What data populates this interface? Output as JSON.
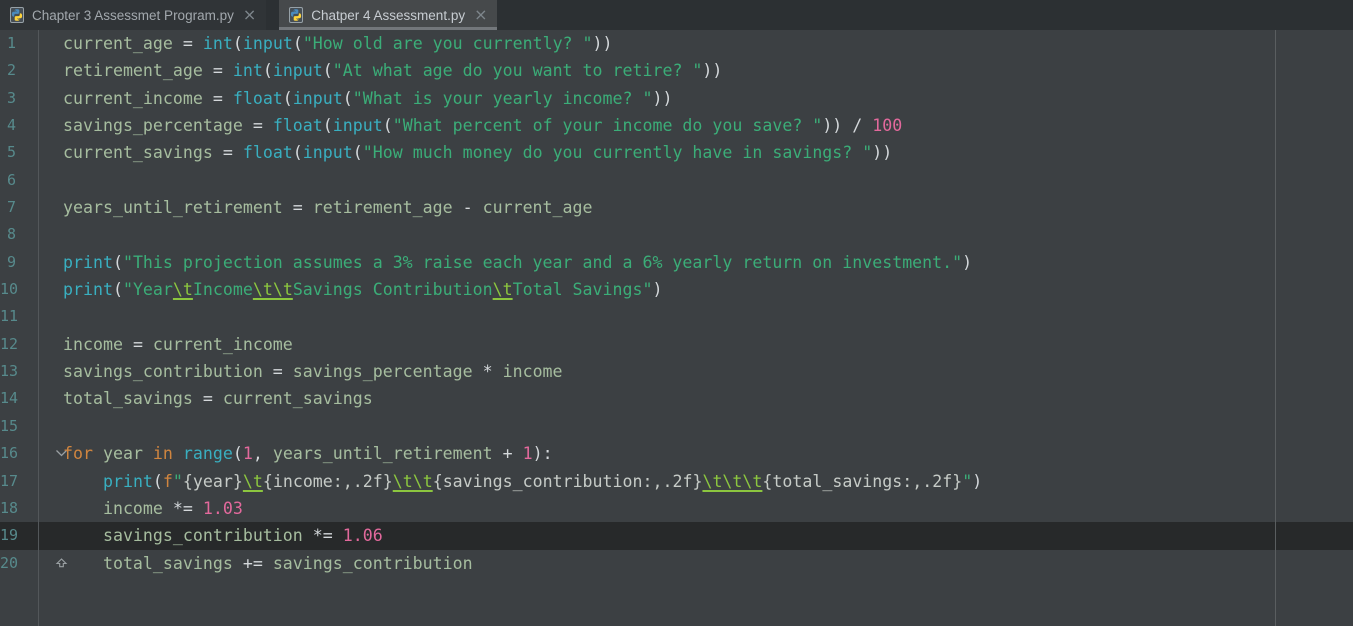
{
  "tabs": [
    {
      "label": "Chapter 3 Assessmet Program.py",
      "close": "×",
      "selected": false,
      "file_icon": "python-file-icon"
    },
    {
      "label": "Chatper 4 Assessment.py",
      "close": "×",
      "selected": true,
      "file_icon": "python-file-icon"
    }
  ],
  "colors": {
    "editor_background": "#3c4043",
    "caret_line_background": "#27292a",
    "selected_tab_background": "#46494b",
    "line_number": "#578a8c",
    "builtin_function": "#39afc0",
    "string": "#3bad78",
    "escape_sequence": "#8cc63f",
    "number": "#e2699c",
    "keyword": "#d0853f",
    "identifier": "#a6bd9f",
    "python_logo_blue": "#4b8bbe",
    "python_logo_yellow": "#ffd43b"
  },
  "editor": {
    "active_line": 19,
    "margin_guide_x": 1275,
    "lines": [
      {
        "n": 1,
        "tokens": [
          [
            "v",
            "current_age "
          ],
          [
            "o",
            "= "
          ],
          [
            "b",
            "int"
          ],
          [
            "o",
            "("
          ],
          [
            "b",
            "input"
          ],
          [
            "o",
            "("
          ],
          [
            "s",
            "\"How old are you currently? \""
          ],
          [
            "o",
            "))"
          ]
        ]
      },
      {
        "n": 2,
        "tokens": [
          [
            "v",
            "retirement_age "
          ],
          [
            "o",
            "= "
          ],
          [
            "b",
            "int"
          ],
          [
            "o",
            "("
          ],
          [
            "b",
            "input"
          ],
          [
            "o",
            "("
          ],
          [
            "s",
            "\"At what age do you want to retire? \""
          ],
          [
            "o",
            "))"
          ]
        ]
      },
      {
        "n": 3,
        "tokens": [
          [
            "v",
            "current_income "
          ],
          [
            "o",
            "= "
          ],
          [
            "b",
            "float"
          ],
          [
            "o",
            "("
          ],
          [
            "b",
            "input"
          ],
          [
            "o",
            "("
          ],
          [
            "s",
            "\"What is your yearly income? \""
          ],
          [
            "o",
            "))"
          ]
        ]
      },
      {
        "n": 4,
        "tokens": [
          [
            "v",
            "savings_percentage "
          ],
          [
            "o",
            "= "
          ],
          [
            "b",
            "float"
          ],
          [
            "o",
            "("
          ],
          [
            "b",
            "input"
          ],
          [
            "o",
            "("
          ],
          [
            "s",
            "\"What percent of your income do you save? \""
          ],
          [
            "o",
            ")) / "
          ],
          [
            "n",
            "100"
          ]
        ]
      },
      {
        "n": 5,
        "tokens": [
          [
            "v",
            "current_savings "
          ],
          [
            "o",
            "= "
          ],
          [
            "b",
            "float"
          ],
          [
            "o",
            "("
          ],
          [
            "b",
            "input"
          ],
          [
            "o",
            "("
          ],
          [
            "s",
            "\"How much money do you currently have in savings? \""
          ],
          [
            "o",
            "))"
          ]
        ]
      },
      {
        "n": 6,
        "tokens": []
      },
      {
        "n": 7,
        "tokens": [
          [
            "v",
            "years_until_retirement "
          ],
          [
            "o",
            "= "
          ],
          [
            "v",
            "retirement_age "
          ],
          [
            "o",
            "- "
          ],
          [
            "v",
            "current_age"
          ]
        ]
      },
      {
        "n": 8,
        "tokens": []
      },
      {
        "n": 9,
        "tokens": [
          [
            "b",
            "print"
          ],
          [
            "o",
            "("
          ],
          [
            "s",
            "\"This projection assumes a 3% raise each year and a 6% yearly return on investment.\""
          ],
          [
            "o",
            ")"
          ]
        ]
      },
      {
        "n": 10,
        "tokens": [
          [
            "b",
            "print"
          ],
          [
            "o",
            "("
          ],
          [
            "s",
            "\"Year"
          ],
          [
            "e",
            "\\t"
          ],
          [
            "s",
            "Income"
          ],
          [
            "e",
            "\\t\\t"
          ],
          [
            "s",
            "Savings Contribution"
          ],
          [
            "e",
            "\\t"
          ],
          [
            "s",
            "Total Savings\""
          ],
          [
            "o",
            ")"
          ]
        ]
      },
      {
        "n": 11,
        "tokens": []
      },
      {
        "n": 12,
        "tokens": [
          [
            "v",
            "income "
          ],
          [
            "o",
            "= "
          ],
          [
            "v",
            "current_income"
          ]
        ]
      },
      {
        "n": 13,
        "tokens": [
          [
            "v",
            "savings_contribution "
          ],
          [
            "o",
            "= "
          ],
          [
            "v",
            "savings_percentage "
          ],
          [
            "o",
            "* "
          ],
          [
            "v",
            "income"
          ]
        ]
      },
      {
        "n": 14,
        "tokens": [
          [
            "v",
            "total_savings "
          ],
          [
            "o",
            "= "
          ],
          [
            "v",
            "current_savings"
          ]
        ]
      },
      {
        "n": 15,
        "tokens": []
      },
      {
        "n": 16,
        "fold": "down",
        "tokens": [
          [
            "k",
            "for "
          ],
          [
            "v",
            "year "
          ],
          [
            "k",
            "in "
          ],
          [
            "b",
            "range"
          ],
          [
            "o",
            "("
          ],
          [
            "n",
            "1"
          ],
          [
            "o",
            ", "
          ],
          [
            "v",
            "years_until_retirement "
          ],
          [
            "o",
            "+ "
          ],
          [
            "n",
            "1"
          ],
          [
            "o",
            "):"
          ]
        ]
      },
      {
        "n": 17,
        "tokens": [
          [
            "v",
            "    "
          ],
          [
            "b",
            "print"
          ],
          [
            "o",
            "("
          ],
          [
            "k",
            "f"
          ],
          [
            "s",
            "\""
          ],
          [
            "br",
            "{year}"
          ],
          [
            "e",
            "\\t"
          ],
          [
            "br",
            "{income:,.2f}"
          ],
          [
            "e",
            "\\t\\t"
          ],
          [
            "br",
            "{savings_contribution:,.2f}"
          ],
          [
            "e",
            "\\t\\t\\t"
          ],
          [
            "br",
            "{total_savings:,.2f}"
          ],
          [
            "s",
            "\""
          ],
          [
            "o",
            ")"
          ]
        ]
      },
      {
        "n": 18,
        "tokens": [
          [
            "v",
            "    income "
          ],
          [
            "o",
            "*= "
          ],
          [
            "n",
            "1.03"
          ]
        ]
      },
      {
        "n": 19,
        "active": true,
        "tokens": [
          [
            "v",
            "    savings_contribution "
          ],
          [
            "o",
            "*= "
          ],
          [
            "n",
            "1.06"
          ]
        ]
      },
      {
        "n": 20,
        "fold": "up",
        "tokens": [
          [
            "v",
            "    total_savings "
          ],
          [
            "o",
            "+= "
          ],
          [
            "v",
            "savings_contribution"
          ]
        ]
      }
    ]
  }
}
